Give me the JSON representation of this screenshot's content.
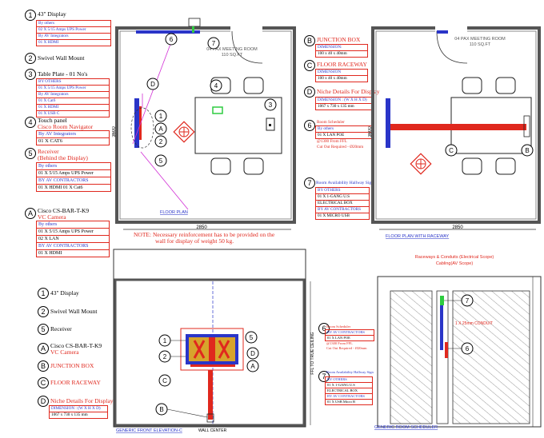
{
  "legend_top": {
    "items": [
      {
        "n": "1",
        "title": "43\" Display",
        "rows": [
          "By others",
          "02 X 5/15 Amps UPS Power",
          "By AV Integrators",
          "01 X HDMI"
        ]
      },
      {
        "n": "2",
        "title": "Swivel  Wall Mount"
      },
      {
        "n": "3",
        "title": "Table Plate - 01 No's",
        "rows": [
          "BY OTHERS",
          "01 X 5/15 Amps UPS Power",
          "By AV Integrators",
          "01 X Cat6",
          "01 X HDMI",
          "01 X USB C"
        ]
      },
      {
        "n": "4",
        "title": "Touch panel",
        "subtitle": "Cisco Room Navigator",
        "rows": [
          "By AV Integrators",
          "01 X CAT6"
        ]
      },
      {
        "n": "5",
        "title": "Receiver",
        "subtitle": "(Behind the Display)",
        "rows": [
          "By others",
          "01 X 5/15 Amps UPS Power",
          "BY AV CONTRACTORS",
          "01 X HDMI       01 X Cat6"
        ]
      },
      {
        "n": "A",
        "title": "Cisco CS-BAR-T-K9",
        "subtitle": "VC Camera",
        "rows": [
          "By others",
          "01 X 5/15 Amps UPS Power",
          "02 X LAN",
          "BY AV CONTRACTORS",
          "01 X HDMI"
        ]
      }
    ]
  },
  "legend_mid": {
    "items": [
      {
        "n": "B",
        "title": "JUNCTION BOX",
        "rows": [
          "DIMENSION:",
          "100 x 40 x 40mm"
        ]
      },
      {
        "n": "C",
        "title": "FLOOR RACEWAY",
        "rows": [
          "DIMENSION",
          "100 x 40 x 40mm"
        ]
      },
      {
        "n": "D",
        "title": "Niche Details For Display",
        "rows": [
          "DIMENSION : (W X H X D)",
          "1067 x 730 x 135 mm"
        ]
      },
      {
        "n": "6",
        "title": "Room Scheduler",
        "rows": [
          "By others",
          "01 X LAN POE",
          "@1300 From FFL",
          "Cut Out Required - Ø20mm"
        ]
      },
      {
        "n": "7",
        "title": "Room Availability Hallway Sign",
        "rows": [
          "BY OTHERS",
          "01 X 1-GANG U.S",
          "ELECTRICAL BOX",
          "BY AV CONTRACTORS",
          "01 X MICRO USB"
        ]
      }
    ]
  },
  "legend_bottom": {
    "items": [
      {
        "n": "1",
        "title": "43\" Display"
      },
      {
        "n": "2",
        "title": "Swivel Wall Mount"
      },
      {
        "n": "5",
        "title": "Receiver"
      },
      {
        "n": "A",
        "title": "Cisco CS-BAR-T-K9",
        "subtitle": "VC Camera"
      },
      {
        "n": "B",
        "title": "JUNCTION BOX"
      },
      {
        "n": "C",
        "title": "FLOOR RACEWAY"
      },
      {
        "n": "D",
        "title": "Niche Details For Display",
        "rows": [
          "DIMENSION : (W X H X D)",
          "1067 x 730 x 135 mm"
        ]
      }
    ]
  },
  "plan1": {
    "room": "04 PAX MEETING ROOM",
    "area": "110 SQ.FT",
    "caption": "FLOOR PLAN",
    "dim_w": "2850",
    "dim_h": "3600"
  },
  "plan2": {
    "room": "04 PAX MEETING ROOM",
    "area": "110 SQ.FT",
    "caption": "FLOOR PLAN WITH RACEWAY",
    "dim_w": "2850",
    "dim_h": "3600"
  },
  "note": {
    "line1": "NOTE: Necessary reinforcement has to be provided on the",
    "line2": "wall for display of weight 50 kg."
  },
  "elevation": {
    "caption": "GENERIC FRONT ELEVATION-C",
    "wall_center": "WALL CENTER",
    "dim": "FFL TO TRUE CEILING"
  },
  "scheduler": {
    "caption": "GENERIC ROOM SCHEDULER",
    "title1": "Raceways & Conduits (Electrical Scope)",
    "title2": "Cabling(AV Scope)",
    "conduit": "1 X 25mm CONDUIT",
    "box6": [
      "Room Scheduler",
      "BY AV CONTRACTORS",
      "01 X LAN POE",
      "@1300 From FFL",
      "Cut Out Required - Ø20mm"
    ],
    "box7": [
      "Room Availability Hallway Sign",
      "BY OTHERS",
      "01 X 1-GANG U.S",
      "ELECTRICAL BOX",
      "BY AV CONTRACTORS",
      "01 X USB Micro B"
    ]
  },
  "colors": {
    "red": "#e0281e",
    "blue": "#2a35c8",
    "magenta": "#d22fd6",
    "green": "#2ecc40",
    "hatch": "#333333"
  }
}
